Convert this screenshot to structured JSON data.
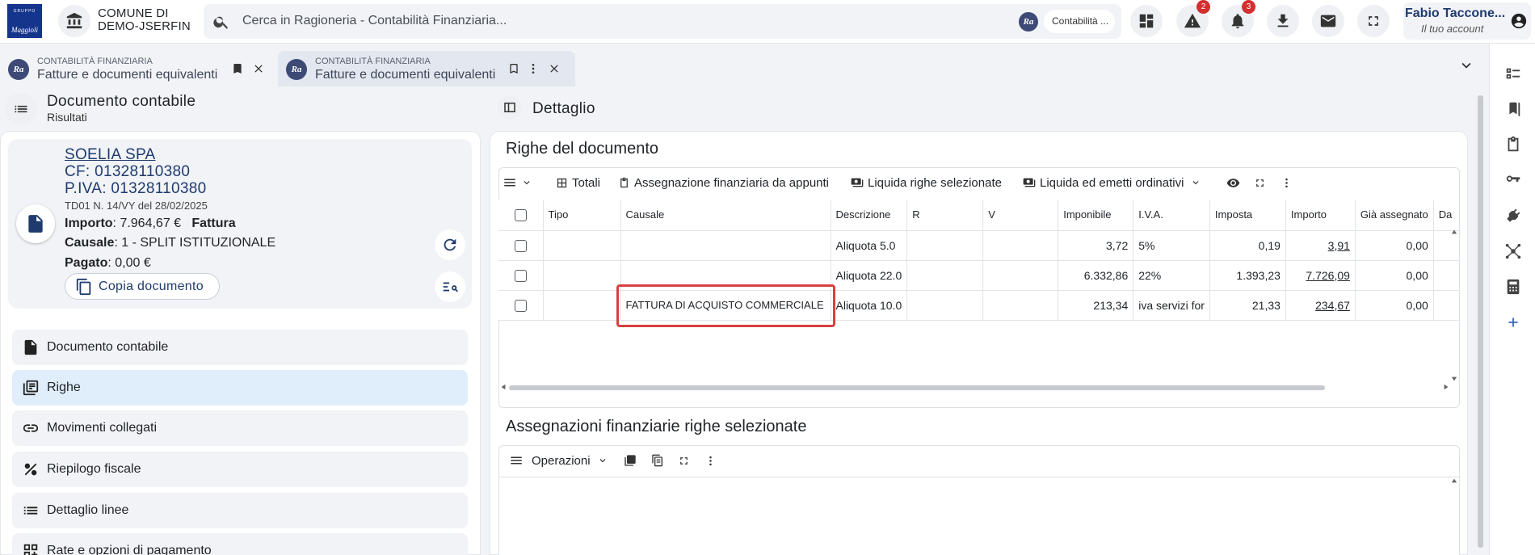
{
  "logo": {
    "top_text": "GRUPPO",
    "brand": "Maggioli"
  },
  "org": {
    "line1": "COMUNE DI",
    "line2": "DEMO-JSERFIN"
  },
  "search": {
    "placeholder": "Cerca in Ragioneria - Contabilità Finanziaria...",
    "chip_label": "Contabilità ...",
    "chip_badge": "Ra"
  },
  "notifications": {
    "warnings_count": "2",
    "bell_count": "3"
  },
  "account": {
    "name": "Fabio Taccone...",
    "subtitle": "Il tuo account"
  },
  "tabs": [
    {
      "category": "CONTABILITÀ FINANZIARIA",
      "title": "Fatture e documenti equivalenti",
      "badge": "Ra"
    },
    {
      "category": "CONTABILITÀ FINANZIARIA",
      "title": "Fatture e documenti equivalenti",
      "badge": "Ra"
    }
  ],
  "left_panel": {
    "title": "Documento contabile",
    "subtitle": "Risultati",
    "supplier": {
      "name": "SOELIA SPA",
      "cf": "CF: 01328110380",
      "piva": "P.IVA: 01328110380",
      "doc_ref": "TD01 N. 14/VY del 28/02/2025",
      "importo_label": "Importo",
      "importo_value": ": 7.964,67 €",
      "doc_type": "Fattura",
      "causale_label": "Causale",
      "causale_value": ": 1 - SPLIT ISTITUZIONALE",
      "pagato_label": "Pagato",
      "pagato_value": ": 0,00 €",
      "copy_button": "Copia documento"
    },
    "menu": [
      {
        "label": "Documento contabile",
        "icon": "document-icon",
        "active": false
      },
      {
        "label": "Righe",
        "icon": "library-icon",
        "active": true
      },
      {
        "label": "Movimenti collegati",
        "icon": "link-icon",
        "active": false
      },
      {
        "label": "Riepilogo fiscale",
        "icon": "percent-icon",
        "active": false
      },
      {
        "label": "Dettaglio linee",
        "icon": "list-icon",
        "active": false
      },
      {
        "label": "Rate e opzioni di pagamento",
        "icon": "grid-icon",
        "active": false
      }
    ]
  },
  "detail": {
    "title": "Dettaglio",
    "rows_section": {
      "title": "Righe del documento",
      "toolbar": {
        "totals": "Totali",
        "assign": "Assegnazione finanziaria da appunti",
        "liquidate": "Liquida righe selezionate",
        "liquidate_emit": "Liquida ed emetti ordinativi"
      },
      "columns": [
        "Tipo",
        "Causale",
        "Descrizione",
        "R",
        "V",
        "Imponibile",
        "I.V.A.",
        "Imposta",
        "Importo",
        "Già assegnato",
        "Da"
      ],
      "rows": [
        {
          "tipo": "",
          "causale": "",
          "descrizione": "Aliquota 5.0",
          "r": "",
          "v": "",
          "imponibile": "3,72",
          "iva": "5%",
          "imposta": "0,19",
          "importo": "3,91",
          "gia_assegnato": "0,00"
        },
        {
          "tipo": "",
          "causale": "",
          "descrizione": "Aliquota 22.0",
          "r": "",
          "v": "",
          "imponibile": "6.332,86",
          "iva": "22%",
          "imposta": "1.393,23",
          "importo": "7.726,09",
          "gia_assegnato": "0,00"
        },
        {
          "tipo": "",
          "causale": "FATTURA DI ACQUISTO COMMERCIALE",
          "descrizione": "Aliquota 10.0",
          "r": "",
          "v": "",
          "imponibile": "213,34",
          "iva": "iva servizi for",
          "imposta": "21,33",
          "importo": "234,67",
          "gia_assegnato": "0,00"
        }
      ]
    },
    "assign_section": {
      "title": "Assegnazioni finanziarie righe selezionate",
      "toolbar": {
        "operations": "Operazioni"
      }
    }
  },
  "colors": {
    "accent": "#1f3b6e",
    "active_menu": "#e0edfb",
    "highlight": "#d94040",
    "badge": "#d32f2f"
  }
}
